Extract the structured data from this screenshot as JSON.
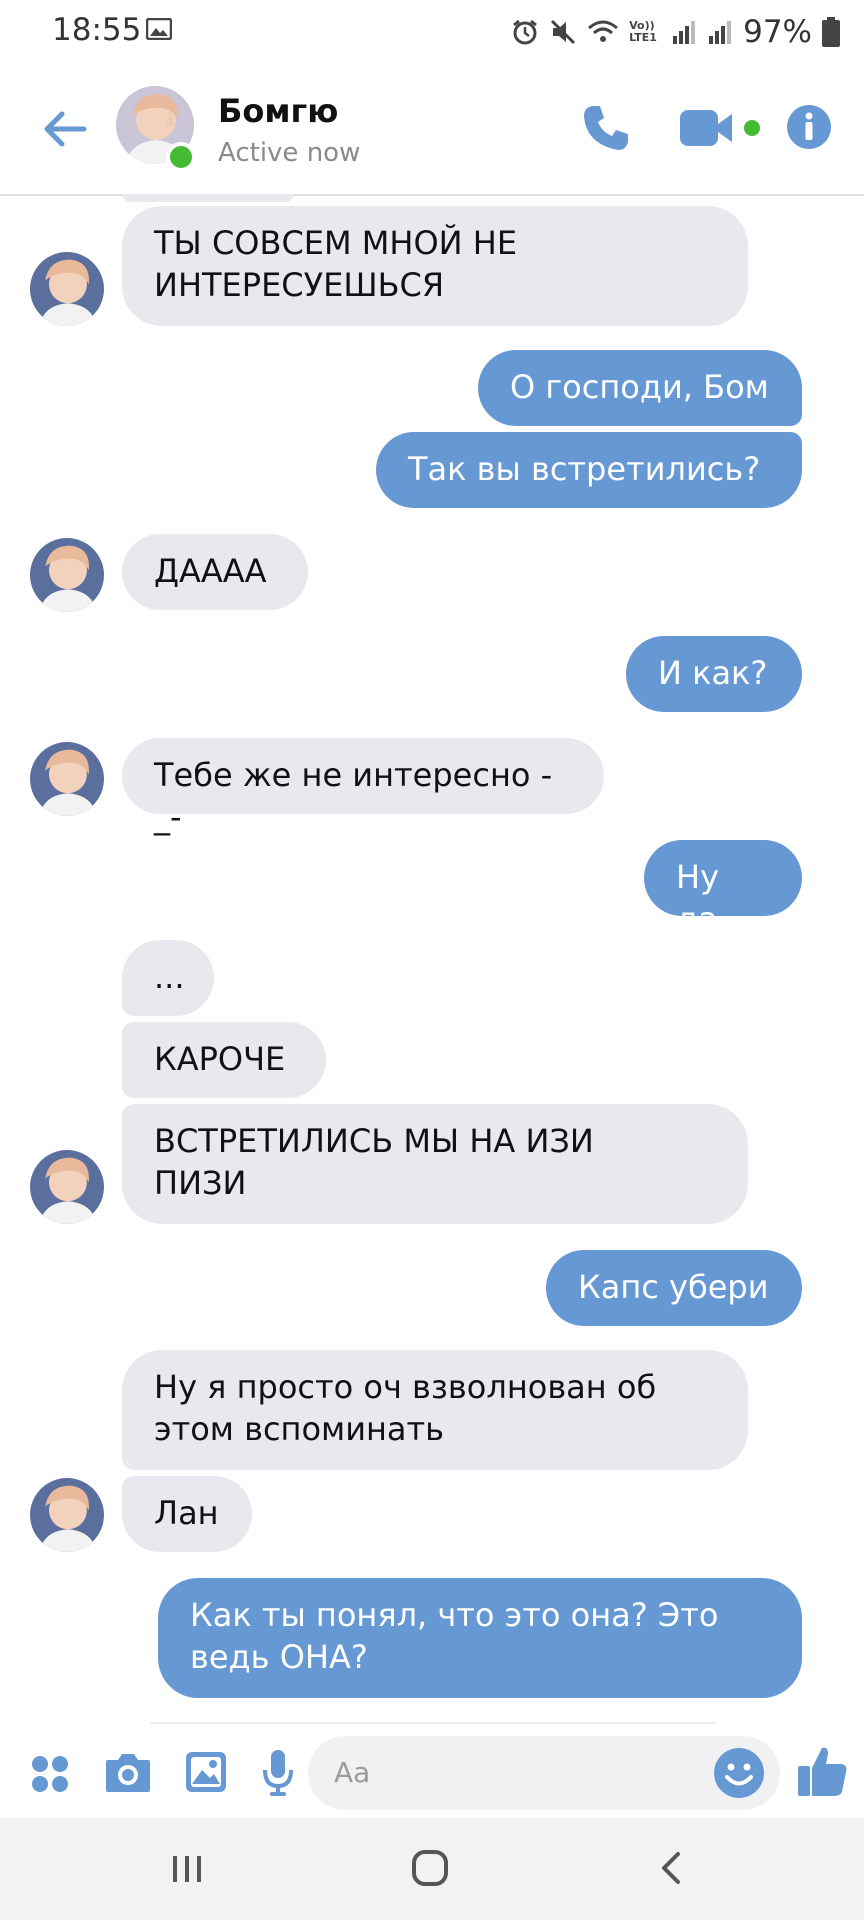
{
  "status_bar": {
    "time": "18:55",
    "battery": "97%",
    "network": "Vo)) LTE1"
  },
  "header": {
    "contact_name": "Бомгю",
    "status": "Active now"
  },
  "colors": {
    "accent": "#6698d4",
    "incoming": "#e9e8ee",
    "online": "#44bb33"
  },
  "messages": [
    {
      "dir": "in",
      "lines": [
        "ТЫ СОВСЕМ МНОЙ НЕ",
        "ИНТЕРЕСУЕШЬСЯ"
      ]
    },
    {
      "dir": "out",
      "lines": [
        "О господи, Бом"
      ]
    },
    {
      "dir": "out",
      "lines": [
        "Так вы встретились?"
      ]
    },
    {
      "dir": "in",
      "lines": [
        "ДАААА"
      ]
    },
    {
      "dir": "out",
      "lines": [
        "И как?"
      ]
    },
    {
      "dir": "in",
      "lines": [
        "Тебе же не интересно -_-"
      ]
    },
    {
      "dir": "out",
      "lines": [
        "Ну да"
      ]
    },
    {
      "dir": "in",
      "lines": [
        "..."
      ]
    },
    {
      "dir": "in",
      "lines": [
        "КАРОЧЕ"
      ]
    },
    {
      "dir": "in",
      "lines": [
        "ВСТРЕТИЛИСЬ МЫ НА ИЗИ",
        "ПИЗИ"
      ]
    },
    {
      "dir": "out",
      "lines": [
        "Капс убери"
      ]
    },
    {
      "dir": "in",
      "lines": [
        "Ну я просто оч взволнован об",
        "этом вспоминать"
      ]
    },
    {
      "dir": "in",
      "lines": [
        "Лан"
      ]
    },
    {
      "dir": "out",
      "lines": [
        "Как ты понял, что это она? Это",
        "ведь ОНА?"
      ]
    }
  ],
  "composer": {
    "placeholder": "Aa"
  },
  "icons": [
    "back-arrow-icon",
    "phone-icon",
    "video-camera-icon",
    "info-icon",
    "apps-icon",
    "camera-icon",
    "gallery-icon",
    "microphone-icon",
    "emoji-icon",
    "thumbs-up-icon",
    "recent-apps-icon",
    "home-icon",
    "nav-back-icon"
  ]
}
